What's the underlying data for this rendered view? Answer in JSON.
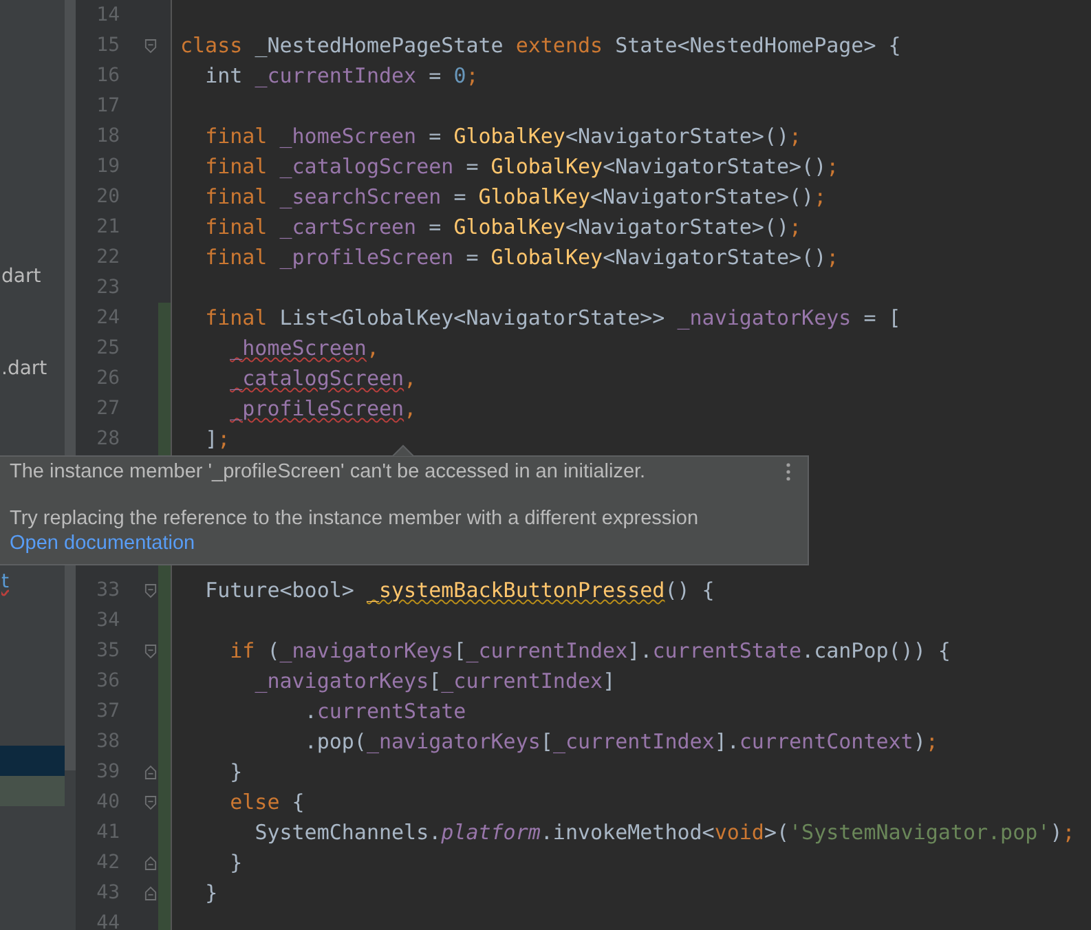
{
  "sidebar": {
    "items": [
      {
        "text": "dart",
        "selected": false,
        "error": false
      },
      {
        "text": ".dart",
        "selected": false,
        "error": false
      },
      {
        "text": "t",
        "selected": false,
        "error": true
      },
      {
        "selected": true
      },
      {
        "selected": false,
        "modified": true
      }
    ]
  },
  "editor": {
    "lines_above": [
      {
        "number": "14"
      },
      {
        "number": "15",
        "fold_start": true,
        "tokens": [
          {
            "t": "class",
            "kind": "kw"
          },
          {
            "t": " _NestedHomePageState",
            "kind": "plain"
          },
          {
            "t": " extends",
            "kind": "kw"
          },
          {
            "t": " State<NestedHomePage> {",
            "kind": "plain"
          }
        ]
      },
      {
        "number": "16",
        "tokens": [
          {
            "t": "  int",
            "kind": "plain"
          },
          {
            "t": " _currentIndex",
            "kind": "field"
          },
          {
            "t": " =",
            "kind": "plain"
          },
          {
            "t": " 0",
            "kind": "num"
          },
          {
            "t": ";",
            "kind": "kw"
          }
        ]
      },
      {
        "number": "17"
      },
      {
        "number": "18",
        "tokens": [
          {
            "t": "  final",
            "kind": "kw"
          },
          {
            "t": " _homeScreen",
            "kind": "field"
          },
          {
            "t": " =",
            "kind": "plain"
          },
          {
            "t": " GlobalKey",
            "kind": "fn"
          },
          {
            "t": "<NavigatorState>()",
            "kind": "plain"
          },
          {
            "t": ";",
            "kind": "kw"
          }
        ]
      },
      {
        "number": "19",
        "tokens": [
          {
            "t": "  final",
            "kind": "kw"
          },
          {
            "t": " _catalogScreen",
            "kind": "field"
          },
          {
            "t": " =",
            "kind": "plain"
          },
          {
            "t": " GlobalKey",
            "kind": "fn"
          },
          {
            "t": "<NavigatorState>()",
            "kind": "plain"
          },
          {
            "t": ";",
            "kind": "kw"
          }
        ]
      },
      {
        "number": "20",
        "tokens": [
          {
            "t": "  final",
            "kind": "kw"
          },
          {
            "t": " _searchScreen",
            "kind": "field"
          },
          {
            "t": " =",
            "kind": "plain"
          },
          {
            "t": " GlobalKey",
            "kind": "fn"
          },
          {
            "t": "<NavigatorState>()",
            "kind": "plain"
          },
          {
            "t": ";",
            "kind": "kw"
          }
        ]
      },
      {
        "number": "21",
        "tokens": [
          {
            "t": "  final",
            "kind": "kw"
          },
          {
            "t": " _cartScreen",
            "kind": "field"
          },
          {
            "t": " =",
            "kind": "plain"
          },
          {
            "t": " GlobalKey",
            "kind": "fn"
          },
          {
            "t": "<NavigatorState>()",
            "kind": "plain"
          },
          {
            "t": ";",
            "kind": "kw"
          }
        ]
      },
      {
        "number": "22",
        "tokens": [
          {
            "t": "  final",
            "kind": "kw"
          },
          {
            "t": " _profileScreen",
            "kind": "field"
          },
          {
            "t": " =",
            "kind": "plain"
          },
          {
            "t": " GlobalKey",
            "kind": "fn"
          },
          {
            "t": "<NavigatorState>()",
            "kind": "plain"
          },
          {
            "t": ";",
            "kind": "kw"
          }
        ]
      },
      {
        "number": "23"
      },
      {
        "number": "24",
        "changed": true,
        "tokens": [
          {
            "t": "  final",
            "kind": "kw"
          },
          {
            "t": " List<GlobalKey<NavigatorState>>",
            "kind": "plain"
          },
          {
            "t": " _navigatorKeys",
            "kind": "field"
          },
          {
            "t": " = [",
            "kind": "plain"
          }
        ]
      },
      {
        "number": "25",
        "changed": true,
        "tokens": [
          {
            "t": "    _homeScreen",
            "kind": "field",
            "error": true
          },
          {
            "t": ",",
            "kind": "kw"
          }
        ]
      },
      {
        "number": "26",
        "changed": true,
        "tokens": [
          {
            "t": "    _catalogScreen",
            "kind": "field",
            "error": true
          },
          {
            "t": ",",
            "kind": "kw"
          }
        ]
      },
      {
        "number": "27",
        "changed": true,
        "tokens": [
          {
            "t": "    _profileScreen",
            "kind": "field",
            "error": true
          },
          {
            "t": ",",
            "kind": "kw"
          }
        ]
      },
      {
        "number": "28",
        "changed": true,
        "tokens": [
          {
            "t": "  ]",
            "kind": "plain"
          },
          {
            "t": ";",
            "kind": "kw"
          }
        ]
      }
    ],
    "tooltip": {
      "message": "The instance member '_profileScreen' can't be accessed in an initializer.",
      "hint": "Try replacing the reference to the instance member with a different expression",
      "link": "Open documentation"
    },
    "lines_below": [
      {
        "changed": true
      },
      {
        "number": "33",
        "changed": true,
        "fold_start": true,
        "tokens": [
          {
            "t": "  Future<bool>",
            "kind": "plain"
          },
          {
            "t": " _systemBackButtonPressed",
            "kind": "fn",
            "warning": true
          },
          {
            "t": "() {",
            "kind": "plain"
          }
        ]
      },
      {
        "number": "34",
        "changed": true
      },
      {
        "number": "35",
        "changed": true,
        "fold_start": true,
        "tokens": [
          {
            "t": "    if",
            "kind": "kw"
          },
          {
            "t": " (",
            "kind": "plain"
          },
          {
            "t": "_navigatorKeys",
            "kind": "field"
          },
          {
            "t": "[",
            "kind": "plain"
          },
          {
            "t": "_currentIndex",
            "kind": "field"
          },
          {
            "t": "].",
            "kind": "plain"
          },
          {
            "t": "currentState",
            "kind": "field"
          },
          {
            "t": ".canPop()) {",
            "kind": "plain"
          }
        ]
      },
      {
        "number": "36",
        "changed": true,
        "tokens": [
          {
            "t": "      _navigatorKeys",
            "kind": "field"
          },
          {
            "t": "[",
            "kind": "plain"
          },
          {
            "t": "_currentIndex",
            "kind": "field"
          },
          {
            "t": "]",
            "kind": "plain"
          }
        ]
      },
      {
        "number": "37",
        "changed": true,
        "tokens": [
          {
            "t": "          .",
            "kind": "plain"
          },
          {
            "t": "currentState",
            "kind": "field"
          }
        ]
      },
      {
        "number": "38",
        "changed": true,
        "tokens": [
          {
            "t": "          .pop(",
            "kind": "plain"
          },
          {
            "t": "_navigatorKeys",
            "kind": "field"
          },
          {
            "t": "[",
            "kind": "plain"
          },
          {
            "t": "_currentIndex",
            "kind": "field"
          },
          {
            "t": "].",
            "kind": "plain"
          },
          {
            "t": "currentContext",
            "kind": "field"
          },
          {
            "t": ")",
            "kind": "plain"
          },
          {
            "t": ";",
            "kind": "kw"
          }
        ]
      },
      {
        "number": "39",
        "changed": true,
        "fold_end": true,
        "tokens": [
          {
            "t": "    }",
            "kind": "plain"
          }
        ]
      },
      {
        "number": "40",
        "changed": true,
        "fold_start": true,
        "tokens": [
          {
            "t": "    else",
            "kind": "kw"
          },
          {
            "t": " {",
            "kind": "plain"
          }
        ]
      },
      {
        "number": "41",
        "changed": true,
        "tokens": [
          {
            "t": "      SystemChannels.",
            "kind": "plain"
          },
          {
            "t": "platform",
            "kind": "static"
          },
          {
            "t": ".invokeMethod<",
            "kind": "plain"
          },
          {
            "t": "void",
            "kind": "kw"
          },
          {
            "t": ">(",
            "kind": "plain"
          },
          {
            "t": "'SystemNavigator.pop'",
            "kind": "str"
          },
          {
            "t": ")",
            "kind": "plain"
          },
          {
            "t": ";",
            "kind": "kw"
          }
        ]
      },
      {
        "number": "42",
        "changed": true,
        "fold_end": true,
        "tokens": [
          {
            "t": "    }",
            "kind": "plain"
          }
        ]
      },
      {
        "number": "43",
        "changed": true,
        "fold_end": true,
        "tokens": [
          {
            "t": "  }",
            "kind": "plain"
          }
        ]
      },
      {
        "number": "44",
        "changed": true
      }
    ]
  }
}
